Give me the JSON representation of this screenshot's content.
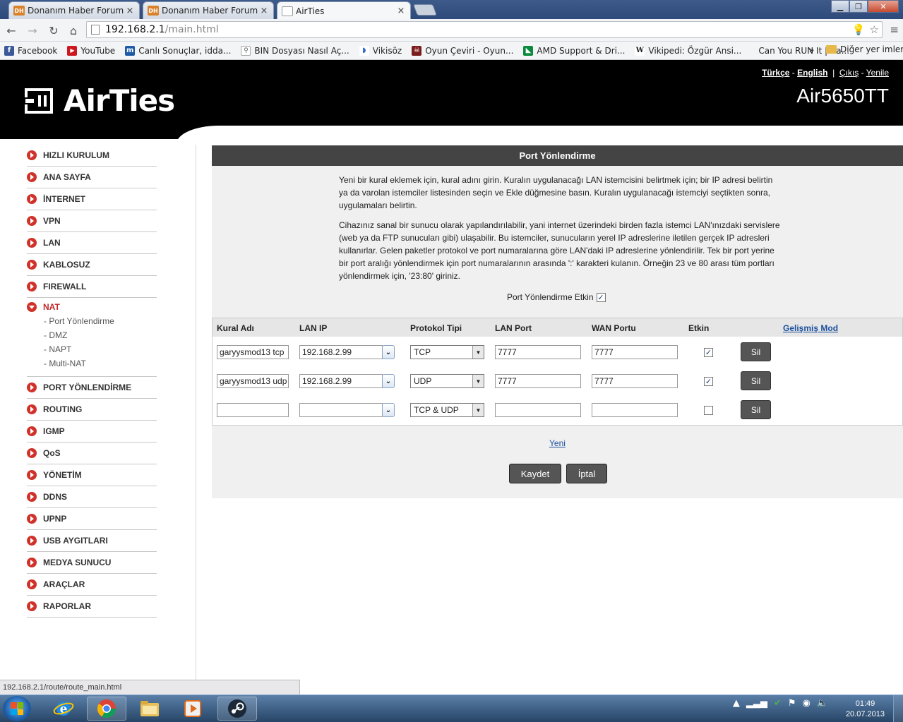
{
  "browser": {
    "tabs": [
      {
        "favicon": "DH",
        "title": "Donanım Haber Forum"
      },
      {
        "favicon": "DH",
        "title": "Donanım Haber Forum"
      },
      {
        "favicon": "",
        "title": "AirTies"
      }
    ],
    "url_host": "192.168.2.1",
    "url_path": "/main.html",
    "bookmarks": [
      {
        "label": "Facebook",
        "icon": "facebook-icon",
        "color": "#3b5998",
        "glyph": "f"
      },
      {
        "label": "YouTube",
        "icon": "youtube-icon",
        "color": "#cc181e",
        "glyph": "▶"
      },
      {
        "label": "Canlı Sonuçlar, idda...",
        "icon": "mackolik-icon",
        "color": "#1f5aa6",
        "glyph": "m"
      },
      {
        "label": "BIN Dosyası Nasıl Aç...",
        "icon": "search-icon",
        "color": "#888888",
        "glyph": "🔍"
      },
      {
        "label": "Vikisöz",
        "icon": "wikiquote-icon",
        "color": "#3366cc",
        "glyph": "◗"
      },
      {
        "label": "Oyun Çeviri - Oyun...",
        "icon": "oyun-ceviri-icon",
        "color": "#7a1c1c",
        "glyph": "☠"
      },
      {
        "label": "AMD Support & Dri...",
        "icon": "amd-icon",
        "color": "#0a8a3a",
        "glyph": "◣"
      },
      {
        "label": "Vikipedi: Özgür Ansi...",
        "icon": "wikipedia-icon",
        "color": "#555555",
        "glyph": "W"
      },
      {
        "label": "Can You RUN It | Ca...",
        "icon": "",
        "color": "",
        "glyph": ""
      }
    ],
    "bookmarks_more": "»",
    "other_bookmarks": "Diğer yer imleri",
    "status_url": "192.168.2.1/route/route_main.html"
  },
  "header": {
    "brand": "AirTies",
    "model": "Air5650TT",
    "lang_tr": "Türkçe",
    "lang_sep": "-",
    "lang_en": "English",
    "pipe": "|",
    "logout": "Çıkış",
    "refresh_sep": "-",
    "refresh": "Yenile"
  },
  "sidebar": {
    "items": [
      "HIZLI KURULUM",
      "ANA SAYFA",
      "İNTERNET",
      "VPN",
      "LAN",
      "KABLOSUZ",
      "FIREWALL"
    ],
    "nat": {
      "label": "NAT",
      "subitems": [
        "- Port Yönlendirme",
        "- DMZ",
        "- NAPT",
        "- Multi-NAT"
      ]
    },
    "items_after": [
      "PORT YÖNLENDİRME",
      "ROUTING",
      "IGMP",
      "QoS",
      "YÖNETİM",
      "DDNS",
      "UPNP",
      "USB AYGITLARI",
      "MEDYA SUNUCU",
      "ARAÇLAR",
      "RAPORLAR"
    ]
  },
  "panel": {
    "title": "Port Yönlendirme",
    "desc1": "Yeni bir kural eklemek için, kural adını girin. Kuralın uygulanacağı LAN istemcisini belirtmek için; bir IP adresi belirtin ya da varolan istemciler listesinden seçin ve Ekle düğmesine basın. Kuralın uygulanacağı istemciyi seçtikten sonra, uygulamaları belirtin.",
    "desc2": "Cihazınız sanal bir sunucu olarak yapılandırılabilir, yani internet üzerindeki birden fazla istemci LAN'ınızdaki servislere (web ya da FTP sunucuları gibi) ulaşabilir. Bu istemciler, sunucuların yerel IP adreslerine iletilen gerçek IP adresleri kullanırlar. Gelen paketler protokol ve port numaralarına göre LAN'daki IP adreslerine yönlendirilir. Tek bir port yerine bir port aralığı yönlendirmek için port numaralarının arasında ':' karakteri kulanın. Örneğin 23 ve 80 arası tüm portları yönlendirmek için, '23:80' giriniz.",
    "enable_label": "Port Yönlendirme Etkin",
    "enabled_mark": "✓",
    "columns": {
      "rule_name": "Kural Adı",
      "lan_ip": "LAN IP",
      "protocol": "Protokol Tipi",
      "lan_port": "LAN Port",
      "wan_port": "WAN Portu",
      "enabled": "Etkin",
      "advanced": "Gelişmiş Mod"
    },
    "rows": [
      {
        "name": "garyysmod13 tcp",
        "ip": "192.168.2.99",
        "protocol": "TCP",
        "lan_port": "7777",
        "wan_port": "7777",
        "check": "✓",
        "delete": "Sil"
      },
      {
        "name": "garyysmod13 udp",
        "ip": "192.168.2.99",
        "protocol": "UDP",
        "lan_port": "7777",
        "wan_port": "7777",
        "check": "✓",
        "delete": "Sil"
      },
      {
        "name": "",
        "ip": "",
        "protocol": "TCP & UDP",
        "lan_port": "",
        "wan_port": "",
        "check": "",
        "delete": "Sil"
      }
    ],
    "new_link": "Yeni",
    "save": "Kaydet",
    "cancel": "İptal"
  },
  "taskbar": {
    "time": "01:49",
    "date": "20.07.2013"
  },
  "colors": {
    "accent_red": "#d0322a",
    "header_black": "#000000",
    "panel_title": "#444444",
    "link_blue": "#1a4f9c"
  }
}
